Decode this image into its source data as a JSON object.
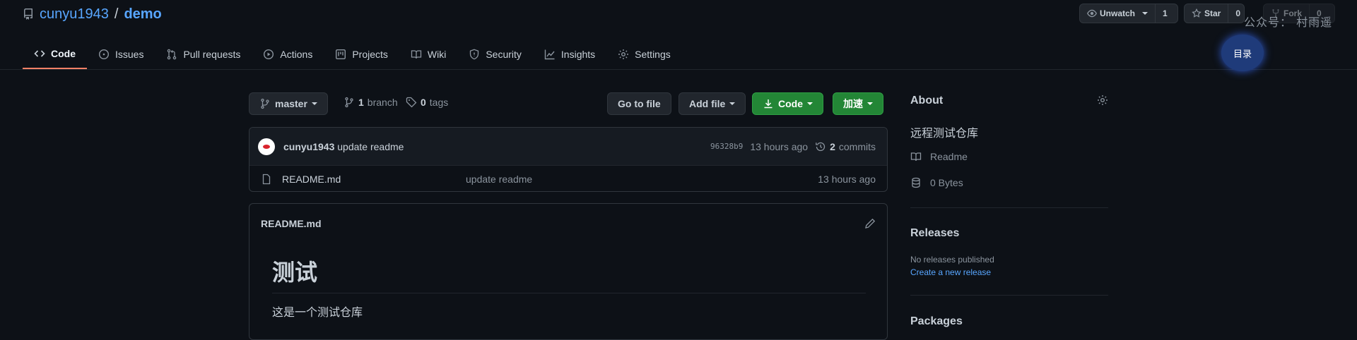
{
  "header": {
    "owner": "cunyu1943",
    "separator": "/",
    "repo": "demo",
    "watch_label": "Unwatch",
    "watch_count": "1",
    "star_label": "Star",
    "star_count": "0",
    "fork_label": "Fork",
    "fork_count": "0",
    "watermark": "公众号：  村雨遥"
  },
  "tabs": [
    {
      "label": "Code",
      "icon": "code-icon"
    },
    {
      "label": "Issues",
      "icon": "issue-icon"
    },
    {
      "label": "Pull requests",
      "icon": "pull-request-icon"
    },
    {
      "label": "Actions",
      "icon": "play-icon"
    },
    {
      "label": "Projects",
      "icon": "project-icon"
    },
    {
      "label": "Wiki",
      "icon": "book-icon"
    },
    {
      "label": "Security",
      "icon": "shield-icon"
    },
    {
      "label": "Insights",
      "icon": "graph-icon"
    },
    {
      "label": "Settings",
      "icon": "gear-icon"
    }
  ],
  "toc_label": "目录",
  "toolbar": {
    "branch_name": "master",
    "branch_count": "1",
    "branch_label": "branch",
    "tag_count": "0",
    "tag_label": "tags",
    "go_to_file": "Go to file",
    "add_file": "Add file",
    "code": "Code",
    "accelerate": "加速"
  },
  "commit": {
    "author": "cunyu1943",
    "message": "update readme",
    "sha": "96328b9",
    "time": "13 hours ago",
    "commit_count": "2",
    "commit_label": "commits"
  },
  "files": [
    {
      "name": "README.md",
      "message": "update readme",
      "time": "13 hours ago"
    }
  ],
  "readme": {
    "title": "README.md",
    "heading": "测试",
    "paragraph": "这是一个测试仓库"
  },
  "about": {
    "title": "About",
    "description": "远程测试仓库",
    "readme_label": "Readme",
    "size_label": "0 Bytes"
  },
  "releases": {
    "title": "Releases",
    "none_text": "No releases published",
    "create_link": "Create a new release"
  },
  "packages": {
    "title": "Packages"
  },
  "colors": {
    "background": "#0d1117",
    "accent_blue": "#58a6ff",
    "green_button": "#238636",
    "tab_underline": "#f78166"
  }
}
